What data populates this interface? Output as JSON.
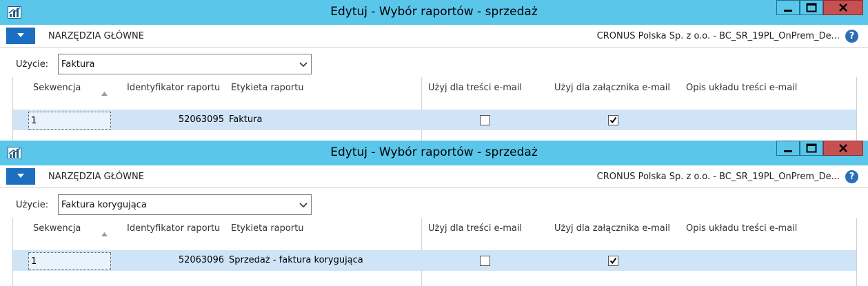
{
  "windows": [
    {
      "title": "Edytuj - Wybór raportów - sprzedaż",
      "ribbon": {
        "home_tab": "NARZĘDZIA GŁÓWNE",
        "company": "CRONUS Polska Sp. z o.o. - BC_SR_19PL_OnPrem_De..."
      },
      "usage": {
        "label": "Użycie:",
        "value": "Faktura"
      },
      "columns": {
        "sequence": "Sekwencja",
        "report_id": "Identyfikator raportu",
        "report_caption": "Etykieta raportu",
        "use_for_email_body": "Użyj dla treści e-mail",
        "use_for_email_attachment": "Użyj dla załącznika e-mail",
        "email_body_layout_description": "Opis układu treści e-mail"
      },
      "rows": [
        {
          "sequence": "1",
          "report_id": "52063095",
          "report_caption": "Faktura",
          "use_for_email_body": false,
          "use_for_email_attachment": true
        }
      ]
    },
    {
      "title": "Edytuj - Wybór raportów - sprzedaż",
      "ribbon": {
        "home_tab": "NARZĘDZIA GŁÓWNE",
        "company": "CRONUS Polska Sp. z o.o. - BC_SR_19PL_OnPrem_De..."
      },
      "usage": {
        "label": "Użycie:",
        "value": "Faktura korygująca"
      },
      "columns": {
        "sequence": "Sekwencja",
        "report_id": "Identyfikator raportu",
        "report_caption": "Etykieta raportu",
        "use_for_email_body": "Użyj dla treści e-mail",
        "use_for_email_attachment": "Użyj dla załącznika e-mail",
        "email_body_layout_description": "Opis układu treści e-mail"
      },
      "rows": [
        {
          "sequence": "1",
          "report_id": "52063096",
          "report_caption": "Sprzedaż - faktura korygująca",
          "use_for_email_body": false,
          "use_for_email_attachment": true
        }
      ]
    }
  ],
  "colors": {
    "titlebar": "#5ac6ea",
    "close_button": "#c75050",
    "menu_button": "#1c6ec1",
    "selected_row": "#cfe4f7",
    "help_icon": "#2a6fb5"
  },
  "icons": {
    "app": "dynamics-app-icon",
    "minimize": "minimize-icon",
    "maximize": "maximize-icon",
    "close": "close-icon",
    "menu": "chevron-down-icon",
    "help": "help-icon",
    "dropdown": "chevron-down-icon",
    "sort": "sort-ascending-icon",
    "checkbox_checked": "checkmark-icon"
  }
}
